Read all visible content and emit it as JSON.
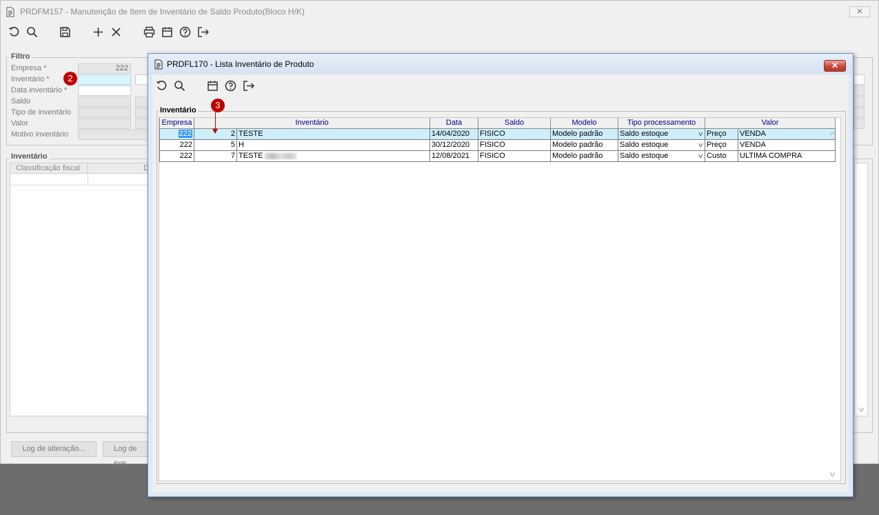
{
  "background_window": {
    "title": "PRDFM157 - Manutenção de Item de Inventário de Saldo Produto(Bloco H/K)",
    "close_glyph": "✕",
    "filter": {
      "legend": "Filtro",
      "labels": {
        "empresa": "Empresa *",
        "inventario": "Inventário *",
        "data_inventario": "Data inventário *",
        "saldo": "Saldo",
        "tipo_inventario": "Tipo de inventário",
        "valor": "Valor",
        "motivo_inventario": "Motivo inventário"
      },
      "empresa_value": "222"
    },
    "inventario_section": {
      "legend": "Inventário",
      "columns": [
        "Classificação fiscal",
        "D"
      ]
    },
    "buttons": {
      "log_alteracao": "Log de alteração...",
      "log_exec": "Log de exe"
    }
  },
  "modal": {
    "title": "PRDFL170 - Lista Inventário de Produto",
    "close_glyph": "✕",
    "group_legend": "Inventário",
    "columns": [
      "Empresa",
      "Inventário",
      "Data",
      "Saldo",
      "Modelo",
      "Tipo processamento",
      "Valor"
    ],
    "rows": [
      {
        "empresa": "222",
        "codigo": "2",
        "descricao": "TESTE",
        "data": "14/04/2020",
        "saldo": "FISICO",
        "modelo": "Modelo padrão",
        "tipo_processamento": "Saldo estoque",
        "valor_tipo": "Preço",
        "valor": "VENDA"
      },
      {
        "empresa": "222",
        "codigo": "5",
        "descricao": "H",
        "data": "30/12/2020",
        "saldo": "FISICO",
        "modelo": "Modelo padrão",
        "tipo_processamento": "Saldo estoque",
        "valor_tipo": "Preço",
        "valor": "VENDA"
      },
      {
        "empresa": "222",
        "codigo": "7",
        "descricao": "TESTE",
        "data": "12/08/2021",
        "saldo": "FISICO",
        "modelo": "Modelo padrão",
        "tipo_processamento": "Saldo estoque",
        "valor_tipo": "Custo",
        "valor": "ULTIMA COMPRA"
      }
    ]
  },
  "annotations": {
    "marker_2": "2",
    "marker_3": "3"
  },
  "icons": {
    "toolbar": [
      "refresh-icon",
      "search-icon",
      "save-icon",
      "add-icon",
      "delete-icon",
      "print-icon",
      "calendar-icon",
      "help-icon",
      "exit-icon"
    ]
  },
  "colors": {
    "selected_row": "#cdeefa",
    "header_text": "#00008b",
    "marker": "#c00000",
    "required_field": "#d7f6ff"
  }
}
